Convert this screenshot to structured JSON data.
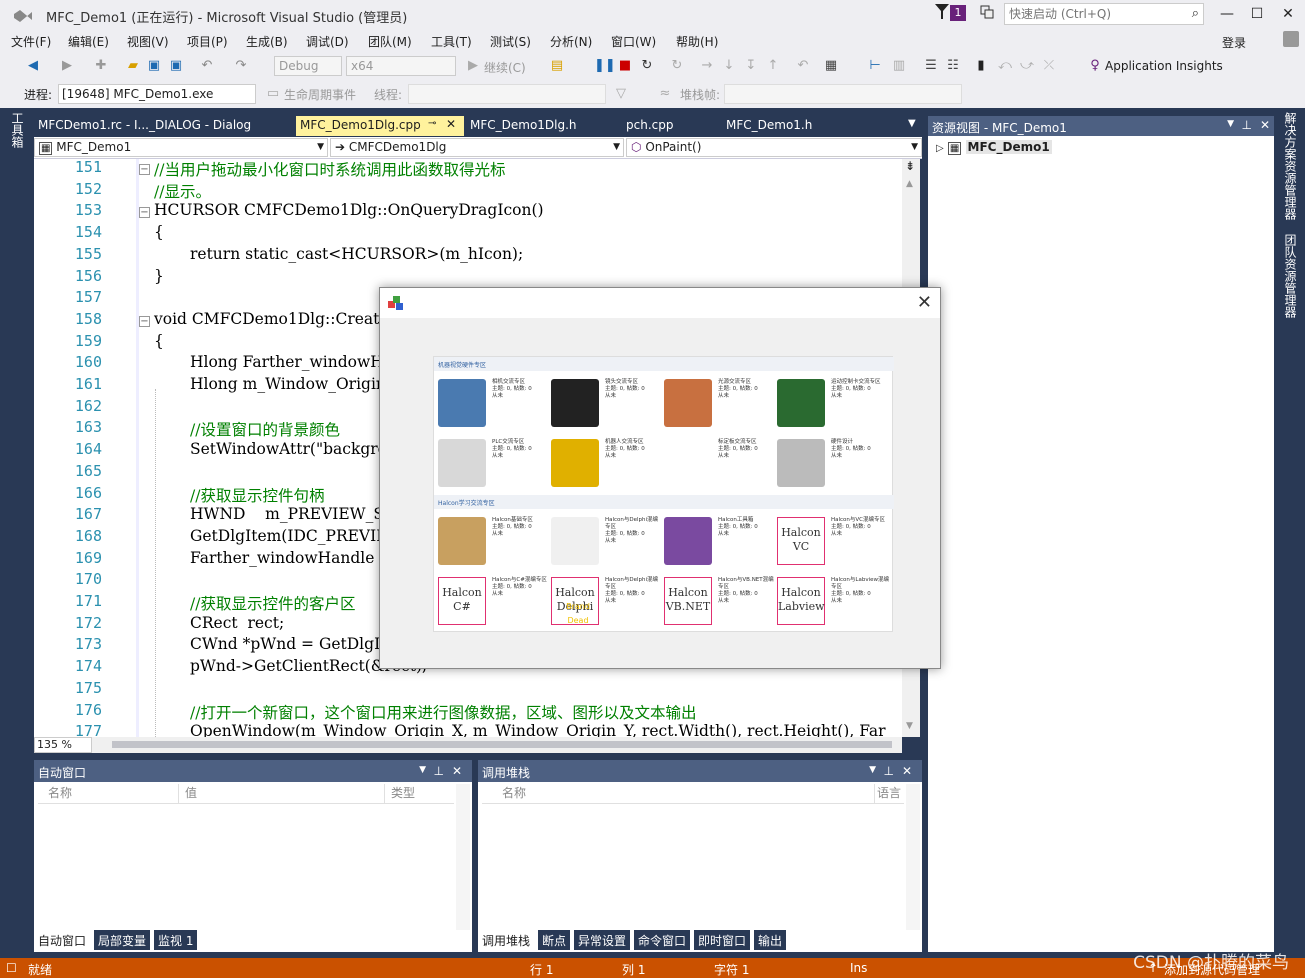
{
  "titlebar": {
    "title": "MFC_Demo1 (正在运行) - Microsoft Visual Studio (管理员)",
    "notif_count": "1",
    "quicklaunch_placeholder": "快速启动 (Ctrl+Q)",
    "signin": "登录"
  },
  "menu": [
    "文件(F)",
    "编辑(E)",
    "视图(V)",
    "项目(P)",
    "生成(B)",
    "调试(D)",
    "团队(M)",
    "工具(T)",
    "测试(S)",
    "分析(N)",
    "窗口(W)",
    "帮助(H)"
  ],
  "toolbar": {
    "config": "Debug",
    "platform": "x64",
    "continue": "继续(C)",
    "app_insights": "Application Insights"
  },
  "toolbar2": {
    "process_label": "进程:",
    "process_value": "[19648] MFC_Demo1.exe",
    "lifecycle": "生命周期事件",
    "thread_label": "线程:",
    "stackframe": "堆栈帧:"
  },
  "lefttool": "工具箱",
  "tabs": [
    "MFCDemo1.rc - I..._DIALOG - Dialog",
    "MFC_Demo1Dlg.cpp",
    "MFC_Demo1Dlg.h",
    "pch.cpp",
    "MFC_Demo1.h"
  ],
  "nav": {
    "project": "MFC_Demo1",
    "class": "CMFCDemo1Dlg",
    "method": "OnPaint()"
  },
  "code": [
    {
      "n": "151",
      "t": "//当用户拖动最小化窗口时系统调用此函数取得光标",
      "c": "#008000",
      "x": 0
    },
    {
      "n": "152",
      "t": "//显示。",
      "c": "#008000",
      "x": 0
    },
    {
      "n": "153",
      "t": "HCURSOR CMFCDemo1Dlg::OnQueryDragIcon()",
      "c": "#000",
      "x": 0
    },
    {
      "n": "154",
      "t": "{",
      "c": "#000",
      "x": 0
    },
    {
      "n": "155",
      "t": "return static_cast<HCURSOR>(m_hIcon);",
      "c": "#000",
      "x": 36
    },
    {
      "n": "156",
      "t": "}",
      "c": "#000",
      "x": 0
    },
    {
      "n": "157",
      "t": "",
      "c": "#000",
      "x": 0
    },
    {
      "n": "158",
      "t": "void CMFCDemo1Dlg::CreateWindow()",
      "c": "#000",
      "x": 0
    },
    {
      "n": "159",
      "t": "{",
      "c": "#000",
      "x": 0
    },
    {
      "n": "160",
      "t": "Hlong Farther_windowHandle;",
      "c": "#000",
      "x": 36
    },
    {
      "n": "161",
      "t": "Hlong m_Window_Origin_X;",
      "c": "#000",
      "x": 36
    },
    {
      "n": "162",
      "t": "",
      "c": "#000",
      "x": 0
    },
    {
      "n": "163",
      "t": "//设置窗口的背景颜色",
      "c": "#008000",
      "x": 36
    },
    {
      "n": "164",
      "t": "SetWindowAttr(\"background_color\", \"black\");",
      "c": "#000",
      "x": 36
    },
    {
      "n": "165",
      "t": "",
      "c": "#000",
      "x": 0
    },
    {
      "n": "166",
      "t": "//获取显示控件句柄",
      "c": "#008000",
      "x": 36
    },
    {
      "n": "167",
      "t": "HWND    m_PREVIEW_STATIC;",
      "c": "#000",
      "x": 36
    },
    {
      "n": "168",
      "t": "GetDlgItem(IDC_PREVIEW_STATIC);",
      "c": "#000",
      "x": 36
    },
    {
      "n": "169",
      "t": "Farther_windowHandle = (Hlong)hwnd;",
      "c": "#000",
      "x": 36
    },
    {
      "n": "170",
      "t": "",
      "c": "#000",
      "x": 0
    },
    {
      "n": "171",
      "t": "//获取显示控件的客户区",
      "c": "#008000",
      "x": 36
    },
    {
      "n": "172",
      "t": "CRect  rect;",
      "c": "#000",
      "x": 36
    },
    {
      "n": "173",
      "t": "CWnd *pWnd = GetDlgItem(IDC_PREVIEW_STATIC);",
      "c": "#000",
      "x": 36
    },
    {
      "n": "174",
      "t": "pWnd->GetClientRect(&rect);",
      "c": "#000",
      "x": 36
    },
    {
      "n": "175",
      "t": "",
      "c": "#000",
      "x": 0
    },
    {
      "n": "176",
      "t": "//打开一个新窗口，这个窗口用来进行图像数据，区域、图形以及文本输出",
      "c": "#008000",
      "x": 36
    },
    {
      "n": "177",
      "t": "OpenWindow(m_Window_Origin_X, m_Window_Origin_Y, rect.Width(), rect.Height(), Far",
      "c": "#000",
      "x": 36
    }
  ],
  "zoom": "135 %",
  "resview": {
    "title": "资源视图 - MFC_Demo1",
    "root": "MFC_Demo1"
  },
  "rightstrip": [
    "解决方案资源管理器",
    "团队资源管理器"
  ],
  "autos": {
    "title": "自动窗口",
    "cols": [
      "名称",
      "值",
      "类型"
    ],
    "tabs": [
      "自动窗口",
      "局部变量",
      "监视 1"
    ]
  },
  "callstack": {
    "title": "调用堆栈",
    "cols": [
      "名称",
      "语言"
    ],
    "tabs": [
      "调用堆栈",
      "断点",
      "异常设置",
      "命令窗口",
      "即时窗口",
      "输出"
    ]
  },
  "status": {
    "ready": "就绪",
    "line": "行 1",
    "col": "列 1",
    "char": "字符 1",
    "ins": "Ins",
    "sourcectl": "添加到源代码管理"
  },
  "watermark": "CSDN @扑腾的菜鸟",
  "portal": {
    "sect1": "机器视觉硬件专区",
    "sect2": "Halcon学习交流专区",
    "row1": [
      {
        "t": "相机交流专区",
        "s": "主题: 0, 帖数: 0",
        "m": "从未"
      },
      {
        "t": "镜头交流专区",
        "s": "主题: 0, 帖数: 0",
        "m": "从未"
      },
      {
        "t": "光源交流专区",
        "s": "主题: 0, 帖数: 0",
        "m": "从未"
      },
      {
        "t": "运动控制卡交流专区",
        "s": "主题: 0, 帖数: 0",
        "m": "从未"
      }
    ],
    "row2": [
      {
        "t": "PLC交流专区",
        "s": "主题: 0, 帖数: 0",
        "m": "从未"
      },
      {
        "t": "机器人交流专区",
        "s": "主题: 0, 帖数: 0",
        "m": "从未"
      },
      {
        "t": "标定板交流专区",
        "s": "主题: 0, 帖数: 0",
        "m": "从未"
      },
      {
        "t": "硬件设计",
        "s": "主题: 0, 帖数: 0",
        "m": "从未"
      }
    ],
    "row3": [
      {
        "t": "Halcon基础专区",
        "s": "主题: 0, 帖数: 0",
        "m": "从未"
      },
      {
        "t": "Halcon与Delphi混编专区",
        "s": "主题: 0, 帖数: 0",
        "m": "从未"
      },
      {
        "t": "Halcon工具箱",
        "s": "主题: 0, 帖数: 0",
        "m": "从未"
      },
      {
        "t": "Halcon与VC混编专区",
        "s": "主题: 0, 帖数: 0",
        "m": "从未"
      }
    ],
    "row4": [
      {
        "t": "Halcon与C#混编专区",
        "s": "主题: 0, 帖数: 0",
        "m": "从未"
      },
      {
        "t": "Halcon与Delphi混编专区",
        "s": "主题: 0, 帖数: 0",
        "m": "从未"
      },
      {
        "t": "Halcon与VB.NET混编专区",
        "s": "主题: 0, 帖数: 0",
        "m": "从未"
      },
      {
        "t": "Halcon与Labview混编专区",
        "s": "主题: 0, 帖数: 0",
        "m": "从未"
      }
    ],
    "halcon_labels": [
      [
        "Halcon",
        "VC"
      ],
      [
        "Halcon",
        "C#"
      ],
      [
        "Halcon",
        "Delphi"
      ],
      [
        "Halcon",
        "VB.NET"
      ],
      [
        "Halcon",
        "Labview"
      ]
    ],
    "delphi_overlay": "Brand Dead"
  }
}
